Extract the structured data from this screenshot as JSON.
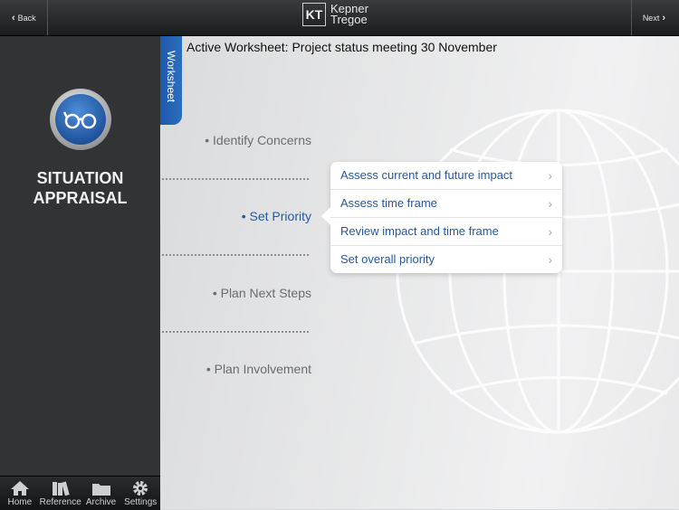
{
  "topbar": {
    "back_label": "Back",
    "next_label": "Next",
    "logo_mark": "KT",
    "logo_line1": "Kepner",
    "logo_line2": "Tregoe"
  },
  "sidebar": {
    "mode_line1": "SITUATION",
    "mode_line2": "APPRAISAL",
    "badge_icon": "glasses-icon"
  },
  "tabs": [
    {
      "label": "Home",
      "icon": "house-icon"
    },
    {
      "label": "Reference",
      "icon": "books-icon"
    },
    {
      "label": "Archive",
      "icon": "folder-icon"
    },
    {
      "label": "Settings",
      "icon": "gear-icon"
    }
  ],
  "worksheet": {
    "tab_label": "Worksheet",
    "active_label": "Active Worksheet: Project status meeting 30 November"
  },
  "steps": [
    {
      "label": "• Identify Concerns",
      "active": false
    },
    {
      "label": "• Set Priority",
      "active": true
    },
    {
      "label": "• Plan Next Steps",
      "active": false
    },
    {
      "label": "• Plan Involvement",
      "active": false
    }
  ],
  "submenu": [
    {
      "label": "Assess current and future impact"
    },
    {
      "label": "Assess time frame"
    },
    {
      "label": "Review impact and time frame"
    },
    {
      "label": "Set overall priority"
    }
  ],
  "colors": {
    "accent": "#235a9e",
    "sidebar": "#323335"
  }
}
